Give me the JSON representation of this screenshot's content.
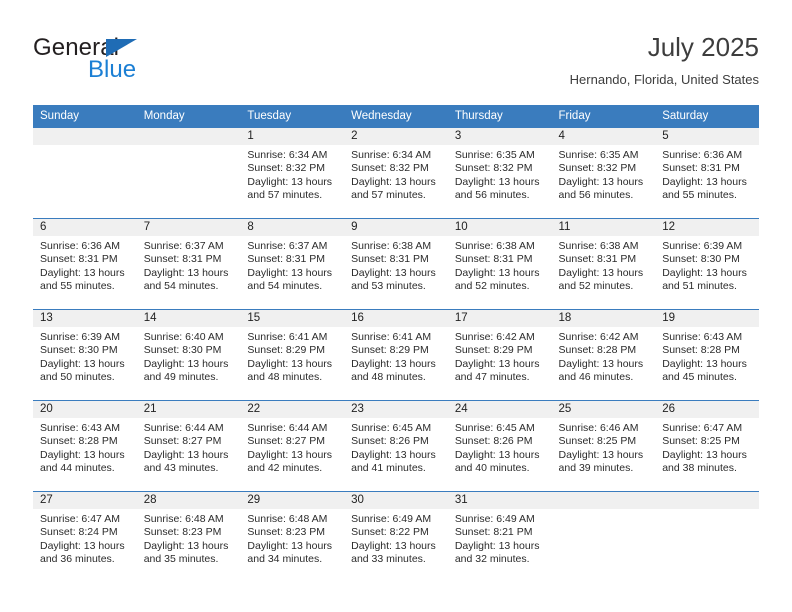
{
  "brand": {
    "name_top": "General",
    "name_bottom": "Blue",
    "triangle_color": "#1f6cb5",
    "blue_text_color": "#1b7fd4"
  },
  "header": {
    "month_title": "July 2025",
    "location": "Hernando, Florida, United States"
  },
  "theme": {
    "header_blue": "#3a7cbe",
    "daynum_band": "#f0f0f0",
    "row_divider": "#3a7cbe"
  },
  "calendar": {
    "weekday_headers": [
      "Sunday",
      "Monday",
      "Tuesday",
      "Wednesday",
      "Thursday",
      "Friday",
      "Saturday"
    ],
    "weeks": [
      [
        {
          "day": "",
          "sunrise": "",
          "sunset": "",
          "daylight_line1": "",
          "daylight_line2": ""
        },
        {
          "day": "",
          "sunrise": "",
          "sunset": "",
          "daylight_line1": "",
          "daylight_line2": ""
        },
        {
          "day": "1",
          "sunrise": "Sunrise: 6:34 AM",
          "sunset": "Sunset: 8:32 PM",
          "daylight_line1": "Daylight: 13 hours",
          "daylight_line2": "and 57 minutes."
        },
        {
          "day": "2",
          "sunrise": "Sunrise: 6:34 AM",
          "sunset": "Sunset: 8:32 PM",
          "daylight_line1": "Daylight: 13 hours",
          "daylight_line2": "and 57 minutes."
        },
        {
          "day": "3",
          "sunrise": "Sunrise: 6:35 AM",
          "sunset": "Sunset: 8:32 PM",
          "daylight_line1": "Daylight: 13 hours",
          "daylight_line2": "and 56 minutes."
        },
        {
          "day": "4",
          "sunrise": "Sunrise: 6:35 AM",
          "sunset": "Sunset: 8:32 PM",
          "daylight_line1": "Daylight: 13 hours",
          "daylight_line2": "and 56 minutes."
        },
        {
          "day": "5",
          "sunrise": "Sunrise: 6:36 AM",
          "sunset": "Sunset: 8:31 PM",
          "daylight_line1": "Daylight: 13 hours",
          "daylight_line2": "and 55 minutes."
        }
      ],
      [
        {
          "day": "6",
          "sunrise": "Sunrise: 6:36 AM",
          "sunset": "Sunset: 8:31 PM",
          "daylight_line1": "Daylight: 13 hours",
          "daylight_line2": "and 55 minutes."
        },
        {
          "day": "7",
          "sunrise": "Sunrise: 6:37 AM",
          "sunset": "Sunset: 8:31 PM",
          "daylight_line1": "Daylight: 13 hours",
          "daylight_line2": "and 54 minutes."
        },
        {
          "day": "8",
          "sunrise": "Sunrise: 6:37 AM",
          "sunset": "Sunset: 8:31 PM",
          "daylight_line1": "Daylight: 13 hours",
          "daylight_line2": "and 54 minutes."
        },
        {
          "day": "9",
          "sunrise": "Sunrise: 6:38 AM",
          "sunset": "Sunset: 8:31 PM",
          "daylight_line1": "Daylight: 13 hours",
          "daylight_line2": "and 53 minutes."
        },
        {
          "day": "10",
          "sunrise": "Sunrise: 6:38 AM",
          "sunset": "Sunset: 8:31 PM",
          "daylight_line1": "Daylight: 13 hours",
          "daylight_line2": "and 52 minutes."
        },
        {
          "day": "11",
          "sunrise": "Sunrise: 6:38 AM",
          "sunset": "Sunset: 8:31 PM",
          "daylight_line1": "Daylight: 13 hours",
          "daylight_line2": "and 52 minutes."
        },
        {
          "day": "12",
          "sunrise": "Sunrise: 6:39 AM",
          "sunset": "Sunset: 8:30 PM",
          "daylight_line1": "Daylight: 13 hours",
          "daylight_line2": "and 51 minutes."
        }
      ],
      [
        {
          "day": "13",
          "sunrise": "Sunrise: 6:39 AM",
          "sunset": "Sunset: 8:30 PM",
          "daylight_line1": "Daylight: 13 hours",
          "daylight_line2": "and 50 minutes."
        },
        {
          "day": "14",
          "sunrise": "Sunrise: 6:40 AM",
          "sunset": "Sunset: 8:30 PM",
          "daylight_line1": "Daylight: 13 hours",
          "daylight_line2": "and 49 minutes."
        },
        {
          "day": "15",
          "sunrise": "Sunrise: 6:41 AM",
          "sunset": "Sunset: 8:29 PM",
          "daylight_line1": "Daylight: 13 hours",
          "daylight_line2": "and 48 minutes."
        },
        {
          "day": "16",
          "sunrise": "Sunrise: 6:41 AM",
          "sunset": "Sunset: 8:29 PM",
          "daylight_line1": "Daylight: 13 hours",
          "daylight_line2": "and 48 minutes."
        },
        {
          "day": "17",
          "sunrise": "Sunrise: 6:42 AM",
          "sunset": "Sunset: 8:29 PM",
          "daylight_line1": "Daylight: 13 hours",
          "daylight_line2": "and 47 minutes."
        },
        {
          "day": "18",
          "sunrise": "Sunrise: 6:42 AM",
          "sunset": "Sunset: 8:28 PM",
          "daylight_line1": "Daylight: 13 hours",
          "daylight_line2": "and 46 minutes."
        },
        {
          "day": "19",
          "sunrise": "Sunrise: 6:43 AM",
          "sunset": "Sunset: 8:28 PM",
          "daylight_line1": "Daylight: 13 hours",
          "daylight_line2": "and 45 minutes."
        }
      ],
      [
        {
          "day": "20",
          "sunrise": "Sunrise: 6:43 AM",
          "sunset": "Sunset: 8:28 PM",
          "daylight_line1": "Daylight: 13 hours",
          "daylight_line2": "and 44 minutes."
        },
        {
          "day": "21",
          "sunrise": "Sunrise: 6:44 AM",
          "sunset": "Sunset: 8:27 PM",
          "daylight_line1": "Daylight: 13 hours",
          "daylight_line2": "and 43 minutes."
        },
        {
          "day": "22",
          "sunrise": "Sunrise: 6:44 AM",
          "sunset": "Sunset: 8:27 PM",
          "daylight_line1": "Daylight: 13 hours",
          "daylight_line2": "and 42 minutes."
        },
        {
          "day": "23",
          "sunrise": "Sunrise: 6:45 AM",
          "sunset": "Sunset: 8:26 PM",
          "daylight_line1": "Daylight: 13 hours",
          "daylight_line2": "and 41 minutes."
        },
        {
          "day": "24",
          "sunrise": "Sunrise: 6:45 AM",
          "sunset": "Sunset: 8:26 PM",
          "daylight_line1": "Daylight: 13 hours",
          "daylight_line2": "and 40 minutes."
        },
        {
          "day": "25",
          "sunrise": "Sunrise: 6:46 AM",
          "sunset": "Sunset: 8:25 PM",
          "daylight_line1": "Daylight: 13 hours",
          "daylight_line2": "and 39 minutes."
        },
        {
          "day": "26",
          "sunrise": "Sunrise: 6:47 AM",
          "sunset": "Sunset: 8:25 PM",
          "daylight_line1": "Daylight: 13 hours",
          "daylight_line2": "and 38 minutes."
        }
      ],
      [
        {
          "day": "27",
          "sunrise": "Sunrise: 6:47 AM",
          "sunset": "Sunset: 8:24 PM",
          "daylight_line1": "Daylight: 13 hours",
          "daylight_line2": "and 36 minutes."
        },
        {
          "day": "28",
          "sunrise": "Sunrise: 6:48 AM",
          "sunset": "Sunset: 8:23 PM",
          "daylight_line1": "Daylight: 13 hours",
          "daylight_line2": "and 35 minutes."
        },
        {
          "day": "29",
          "sunrise": "Sunrise: 6:48 AM",
          "sunset": "Sunset: 8:23 PM",
          "daylight_line1": "Daylight: 13 hours",
          "daylight_line2": "and 34 minutes."
        },
        {
          "day": "30",
          "sunrise": "Sunrise: 6:49 AM",
          "sunset": "Sunset: 8:22 PM",
          "daylight_line1": "Daylight: 13 hours",
          "daylight_line2": "and 33 minutes."
        },
        {
          "day": "31",
          "sunrise": "Sunrise: 6:49 AM",
          "sunset": "Sunset: 8:21 PM",
          "daylight_line1": "Daylight: 13 hours",
          "daylight_line2": "and 32 minutes."
        },
        {
          "day": "",
          "sunrise": "",
          "sunset": "",
          "daylight_line1": "",
          "daylight_line2": ""
        },
        {
          "day": "",
          "sunrise": "",
          "sunset": "",
          "daylight_line1": "",
          "daylight_line2": ""
        }
      ]
    ]
  }
}
